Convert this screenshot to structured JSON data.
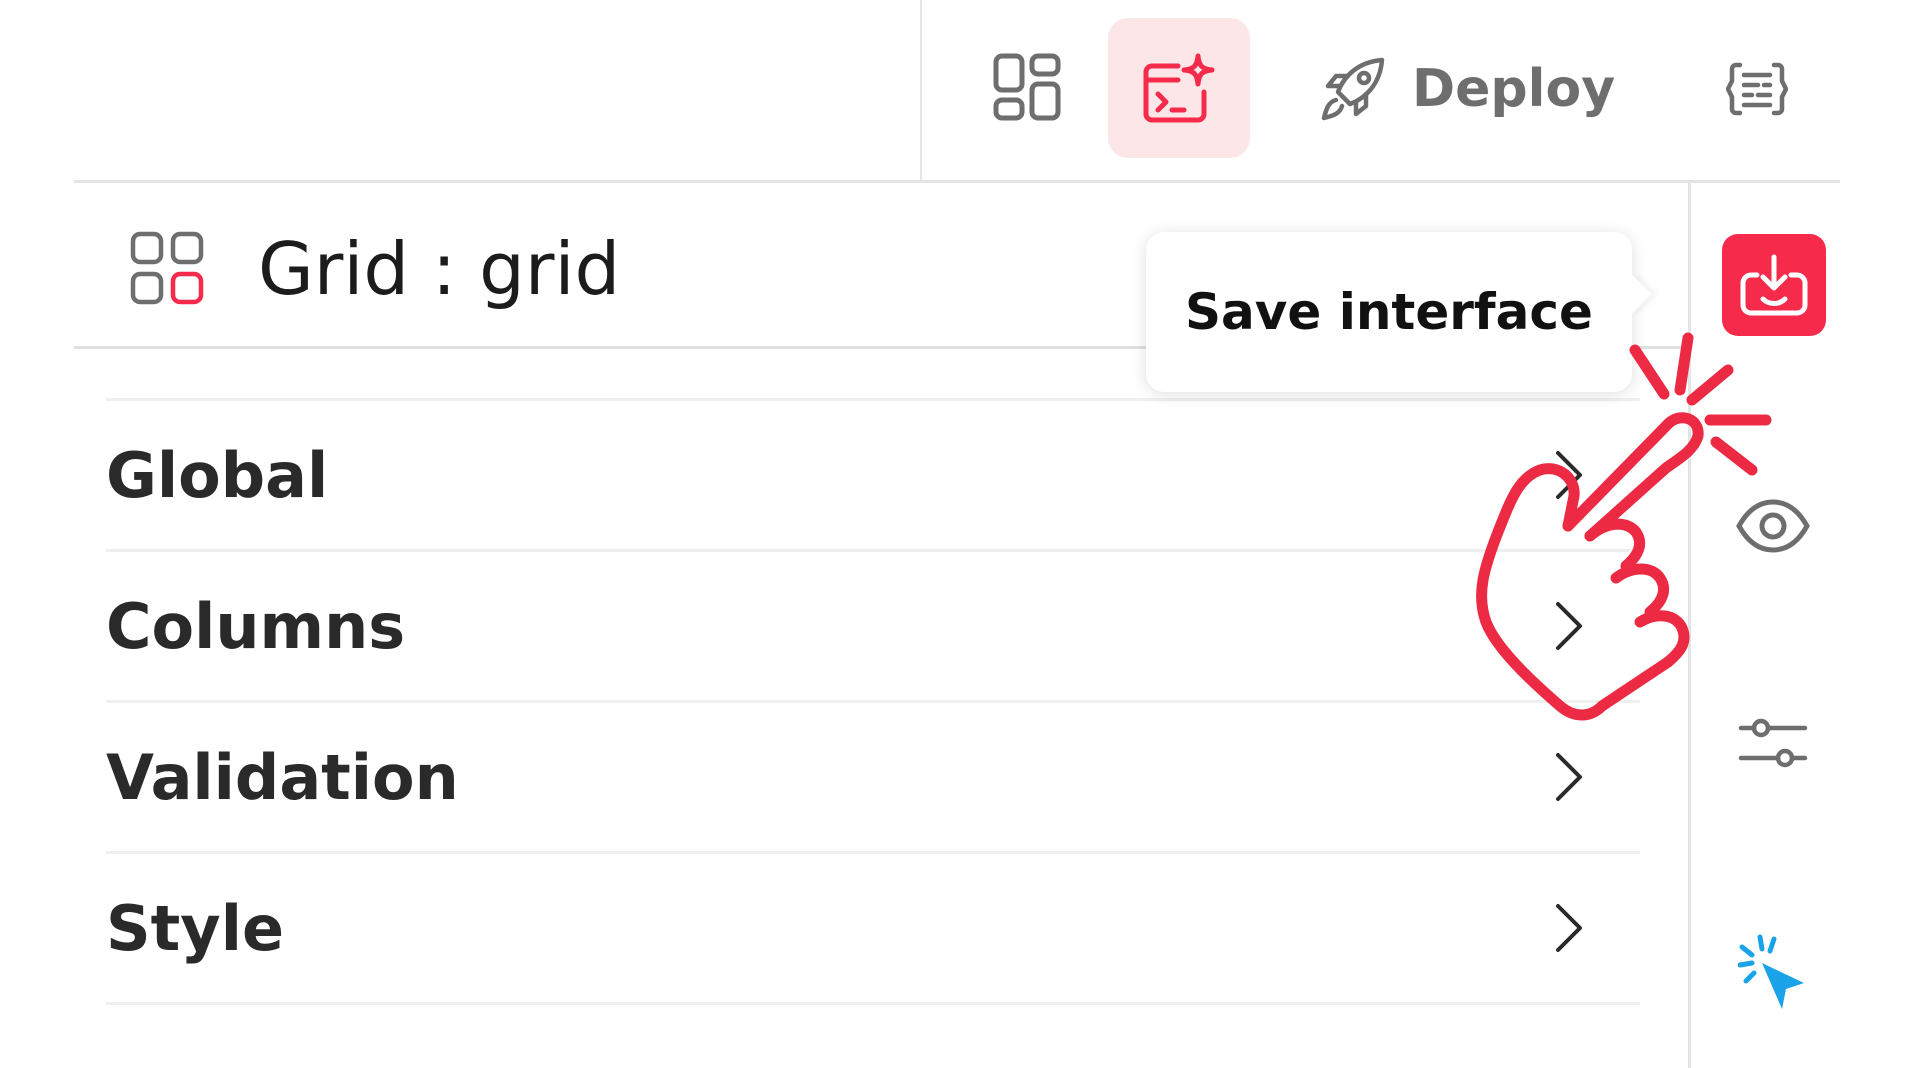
{
  "toolbar": {
    "deploy_label": "Deploy"
  },
  "tooltip": {
    "text": "Save interface"
  },
  "panel": {
    "title": "Grid : grid"
  },
  "menu": {
    "items": [
      {
        "label": "Global"
      },
      {
        "label": "Columns"
      },
      {
        "label": "Validation"
      },
      {
        "label": "Style"
      }
    ]
  },
  "icons": {
    "toolbar": [
      "layout-grid-icon",
      "ai-terminal-icon",
      "rocket-icon",
      "code-braces-icon"
    ],
    "rail": [
      "save-download-icon",
      "eye-icon",
      "sliders-icon",
      "pointer-click-icon"
    ],
    "overlay": "tap-hand-icon"
  },
  "colors": {
    "accent": "#f62b4c",
    "accent_soft": "#fde6e8",
    "pointer_blue": "#1aa3e8",
    "text_dark": "#1c1c1c",
    "text_muted": "#6e6e6e"
  }
}
